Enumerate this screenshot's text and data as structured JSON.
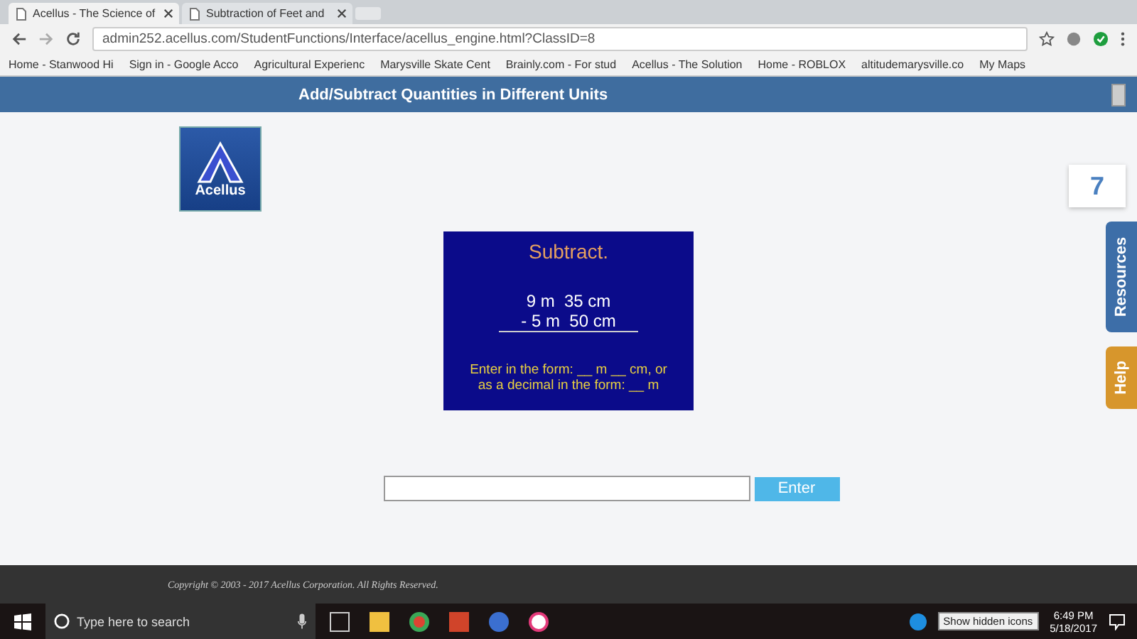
{
  "browser": {
    "tabs": [
      {
        "title": "Acellus - The Science of",
        "selected": true
      },
      {
        "title": "Subtraction of Feet and",
        "selected": false
      }
    ],
    "url": "admin252.acellus.com/StudentFunctions/Interface/acellus_engine.html?ClassID=8",
    "bookmarks": [
      "Home - Stanwood Hi",
      "Sign in - Google Acco",
      "Agricultural Experienc",
      "Marysville Skate Cent",
      "Brainly.com - For stud",
      "Acellus - The Solution",
      "Home - ROBLOX",
      "altitudemarysville.co",
      "My Maps"
    ]
  },
  "app": {
    "title": "Add/Subtract Quantities in Different Units",
    "logo_text": "Acellus",
    "day_number": "7",
    "side_tabs": [
      "Resources",
      "Help"
    ],
    "problem": {
      "heading": "Subtract.",
      "lines": [
        "9 m  35 cm",
        "- 5 m  50 cm"
      ],
      "instructions": [
        "Enter in the form: __ m __ cm, or",
        "as a decimal in the form: __ m"
      ]
    },
    "enter_button": "Enter",
    "copyright": "Copyright © 2003 - 2017 Acellus Corporation.  All Rights Reserved."
  },
  "taskbar": {
    "search_placeholder": "Type here to search",
    "tooltip": "Show hidden icons",
    "time": "6:49 PM",
    "date": "5/18/2017"
  }
}
